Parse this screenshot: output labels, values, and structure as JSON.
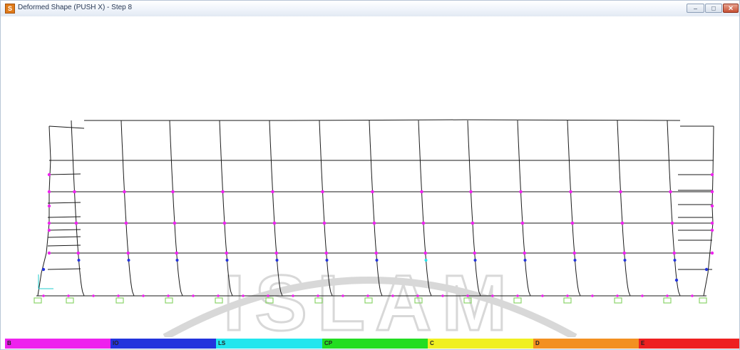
{
  "window": {
    "title": "Deformed Shape (PUSH X) - Step 8",
    "app_icon_glyph": "S",
    "controls": {
      "minimize_glyph": "–",
      "maximize_glyph": "□",
      "close_glyph": "✕"
    }
  },
  "legend": {
    "segments": [
      {
        "label": "B",
        "color": "#ee22ee"
      },
      {
        "label": "IO",
        "color": "#2233dd"
      },
      {
        "label": "LS",
        "color": "#22e6ee"
      },
      {
        "label": "CP",
        "color": "#22dd22"
      },
      {
        "label": "C",
        "color": "#f0f020"
      },
      {
        "label": "D",
        "color": "#f39020"
      },
      {
        "label": "E",
        "color": "#ee2020"
      }
    ]
  },
  "colors": {
    "frame_line": "#1a1a1a",
    "hinge_b": "#ee22ee",
    "hinge_io": "#2233dd",
    "hinge_ls": "#22e6ee",
    "support": "#8bd46a",
    "axis_x": "#22cccc",
    "axis_z": "#22cccc"
  },
  "watermark": {
    "text": "ISLAM",
    "color": "#d8d8d8"
  }
}
